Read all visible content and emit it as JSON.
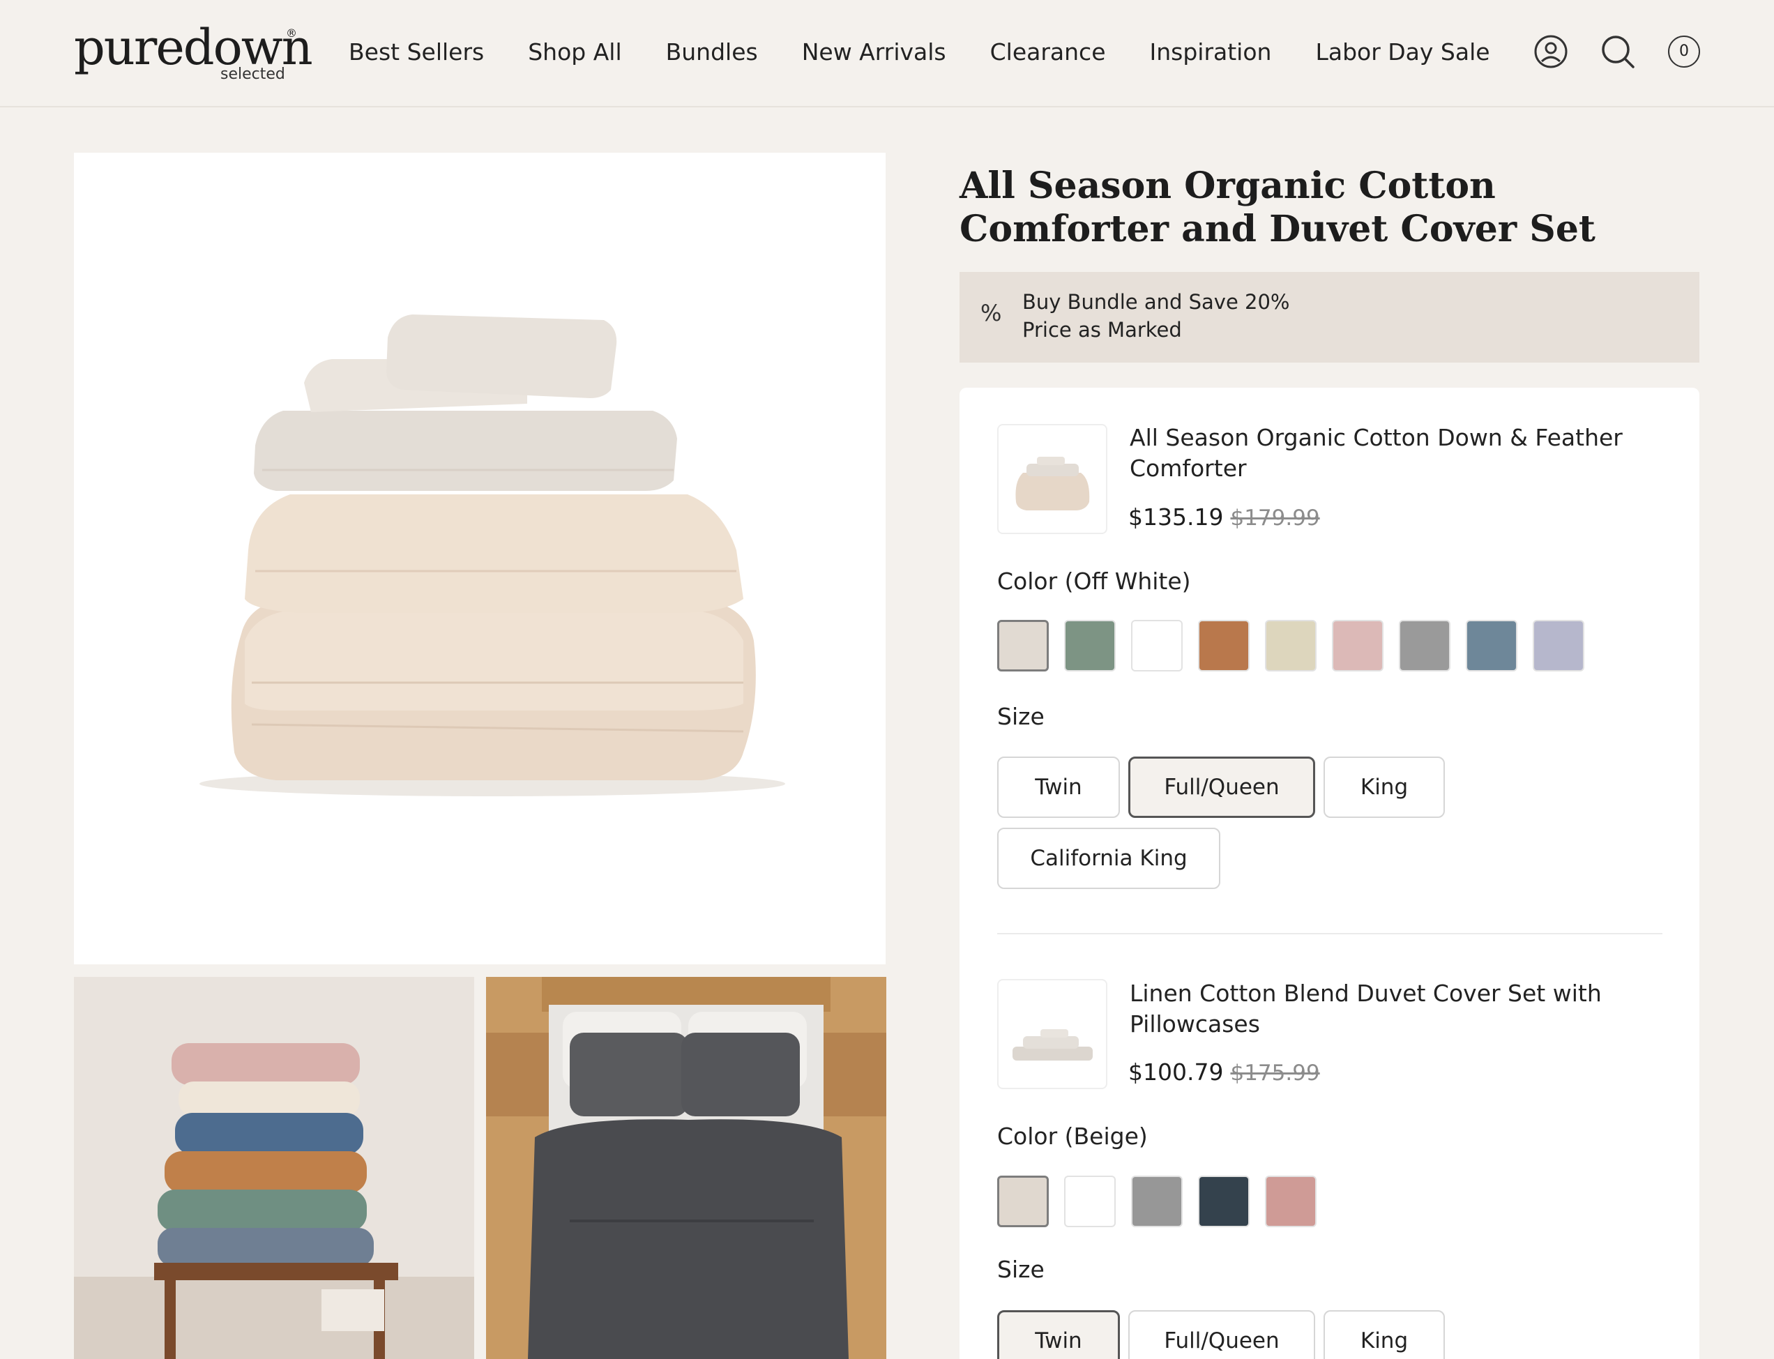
{
  "header": {
    "logo": "puredown",
    "logo_reg": "®",
    "logo_sub": "selected",
    "nav": [
      "Best Sellers",
      "Shop All",
      "Bundles",
      "New Arrivals",
      "Clearance",
      "Inspiration",
      "Labor Day Sale"
    ],
    "cart_count": "0",
    "icons": [
      "account-icon",
      "search-icon",
      "cart-icon"
    ]
  },
  "product": {
    "title": "All Season Organic Cotton Comforter and Duvet Cover Set",
    "promo": {
      "icon": "%",
      "line1": "Buy Bundle and Save 20%",
      "line2": "Price as Marked"
    },
    "items": [
      {
        "name": "All Season Organic Cotton Down & Feather Comforter",
        "price": "$135.19",
        "old_price": "$179.99",
        "color_label": "Color (Off White)",
        "swatches": [
          "#e1dad2",
          "#7d9484",
          "#ffffff",
          "#b9784c",
          "#ddd6bd",
          "#dcb9b7",
          "#9a9a9a",
          "#6e8799",
          "#b6b7cc"
        ],
        "selected_swatch": 0,
        "size_label": "Size",
        "sizes": [
          "Twin",
          "Full/Queen",
          "King",
          "California King"
        ],
        "selected_size": "Full/Queen"
      },
      {
        "name": "Linen Cotton Blend Duvet Cover Set with Pillowcases",
        "price": "$100.79",
        "old_price": "$175.99",
        "color_label": "Color (Beige)",
        "swatches": [
          "#e0d8cf",
          "#ffffff",
          "#979797",
          "#34424d",
          "#cf9b96"
        ],
        "selected_swatch": 0,
        "size_label": "Size",
        "sizes": [
          "Twin",
          "Full/Queen",
          "King"
        ],
        "selected_size": "Twin"
      }
    ]
  }
}
